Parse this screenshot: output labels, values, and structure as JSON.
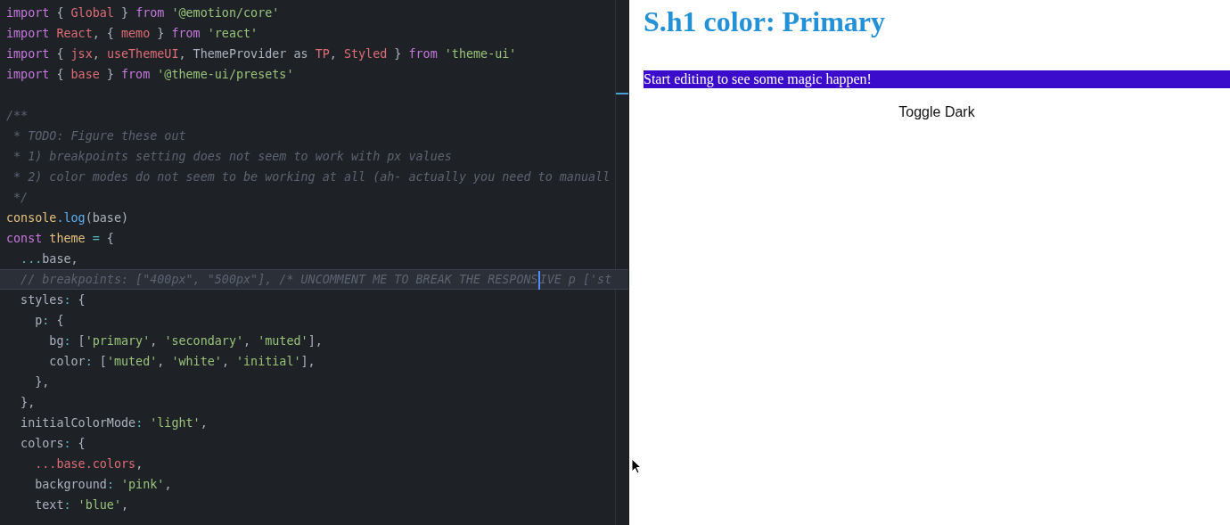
{
  "editor": {
    "lines": [
      {
        "current": false,
        "tokens": [
          {
            "kind": "keyword",
            "text": "import"
          },
          {
            "kind": "plain",
            "text": " { "
          },
          {
            "kind": "variable",
            "text": "Global"
          },
          {
            "kind": "plain",
            "text": " } "
          },
          {
            "kind": "keyword",
            "text": "from"
          },
          {
            "kind": "string",
            "text": " '@emotion/core'"
          }
        ]
      },
      {
        "current": false,
        "tokens": [
          {
            "kind": "keyword",
            "text": "import"
          },
          {
            "kind": "variable",
            "text": " React"
          },
          {
            "kind": "plain",
            "text": ", { "
          },
          {
            "kind": "variable",
            "text": "memo"
          },
          {
            "kind": "plain",
            "text": " } "
          },
          {
            "kind": "keyword",
            "text": "from"
          },
          {
            "kind": "string",
            "text": " 'react'"
          }
        ]
      },
      {
        "current": false,
        "tokens": [
          {
            "kind": "keyword",
            "text": "import"
          },
          {
            "kind": "plain",
            "text": " { "
          },
          {
            "kind": "variable",
            "text": "jsx"
          },
          {
            "kind": "plain",
            "text": ", "
          },
          {
            "kind": "variable",
            "text": "useThemeUI"
          },
          {
            "kind": "plain",
            "text": ", ThemeProvider as "
          },
          {
            "kind": "variable",
            "text": "TP"
          },
          {
            "kind": "plain",
            "text": ", "
          },
          {
            "kind": "variable",
            "text": "Styled"
          },
          {
            "kind": "plain",
            "text": " } "
          },
          {
            "kind": "keyword",
            "text": "from"
          },
          {
            "kind": "string",
            "text": " 'theme-ui'"
          }
        ]
      },
      {
        "current": false,
        "tokens": [
          {
            "kind": "keyword",
            "text": "import"
          },
          {
            "kind": "plain",
            "text": " { "
          },
          {
            "kind": "variable",
            "text": "base"
          },
          {
            "kind": "plain",
            "text": " } "
          },
          {
            "kind": "keyword",
            "text": "from"
          },
          {
            "kind": "string",
            "text": " '@theme-ui/presets'"
          }
        ]
      },
      {
        "current": false
      },
      {
        "current": false,
        "tokens": [
          {
            "kind": "comment",
            "text": "/**"
          }
        ]
      },
      {
        "current": false,
        "tokens": [
          {
            "kind": "comment",
            "text": " * TODO: Figure these out"
          }
        ]
      },
      {
        "current": false,
        "tokens": [
          {
            "kind": "comment",
            "text": " * 1) breakpoints setting does not seem to work with px values"
          }
        ]
      },
      {
        "current": false,
        "tokens": [
          {
            "kind": "comment",
            "text": " * 2) color modes do not seem to be working at all (ah- actually you need to manuall"
          }
        ]
      },
      {
        "current": false,
        "tokens": [
          {
            "kind": "comment",
            "text": " */"
          }
        ]
      },
      {
        "current": false,
        "tokens": [
          {
            "kind": "object",
            "text": "console"
          },
          {
            "kind": "function",
            "text": ".log"
          },
          {
            "kind": "plain",
            "text": "(base)"
          }
        ]
      },
      {
        "current": false,
        "tokens": [
          {
            "kind": "keyword",
            "text": "const"
          },
          {
            "kind": "object",
            "text": " theme"
          },
          {
            "kind": "operator",
            "text": " ="
          },
          {
            "kind": "plain",
            "text": " {"
          }
        ]
      },
      {
        "current": false,
        "tokens": [
          {
            "kind": "operator",
            "text": "  ..."
          },
          {
            "kind": "plain",
            "text": "base,"
          }
        ]
      },
      {
        "current": true,
        "tokens": [
          {
            "kind": "comment",
            "text": "  // breakpoints: [\"400px\", \"500px\"], /* UNCOMMENT ME TO BREAK THE RESPONS"
          },
          {
            "kind": "caret"
          },
          {
            "kind": "comment",
            "text": "IVE p ['st"
          }
        ]
      },
      {
        "current": false,
        "tokens": [
          {
            "kind": "plain",
            "text": "  styles"
          },
          {
            "kind": "operator",
            "text": ":"
          },
          {
            "kind": "plain",
            "text": " {"
          }
        ]
      },
      {
        "current": false,
        "tokens": [
          {
            "kind": "plain",
            "text": "    p"
          },
          {
            "kind": "operator",
            "text": ":"
          },
          {
            "kind": "plain",
            "text": " {"
          }
        ]
      },
      {
        "current": false,
        "tokens": [
          {
            "kind": "plain",
            "text": "      bg"
          },
          {
            "kind": "operator",
            "text": ":"
          },
          {
            "kind": "plain",
            "text": " ["
          },
          {
            "kind": "string",
            "text": "'primary'"
          },
          {
            "kind": "plain",
            "text": ", "
          },
          {
            "kind": "string",
            "text": "'secondary'"
          },
          {
            "kind": "plain",
            "text": ", "
          },
          {
            "kind": "string",
            "text": "'muted'"
          },
          {
            "kind": "plain",
            "text": "],"
          }
        ]
      },
      {
        "current": false,
        "tokens": [
          {
            "kind": "plain",
            "text": "      color"
          },
          {
            "kind": "operator",
            "text": ":"
          },
          {
            "kind": "plain",
            "text": " ["
          },
          {
            "kind": "string",
            "text": "'muted'"
          },
          {
            "kind": "plain",
            "text": ", "
          },
          {
            "kind": "string",
            "text": "'white'"
          },
          {
            "kind": "plain",
            "text": ", "
          },
          {
            "kind": "string",
            "text": "'initial'"
          },
          {
            "kind": "plain",
            "text": "],"
          }
        ]
      },
      {
        "current": false,
        "tokens": [
          {
            "kind": "plain",
            "text": "    },"
          }
        ]
      },
      {
        "current": false,
        "tokens": [
          {
            "kind": "plain",
            "text": "  },"
          }
        ]
      },
      {
        "current": false,
        "tokens": [
          {
            "kind": "plain",
            "text": "  initialColorMode"
          },
          {
            "kind": "operator",
            "text": ":"
          },
          {
            "kind": "string",
            "text": " 'light'"
          },
          {
            "kind": "plain",
            "text": ","
          }
        ]
      },
      {
        "current": false,
        "tokens": [
          {
            "kind": "plain",
            "text": "  colors"
          },
          {
            "kind": "operator",
            "text": ":"
          },
          {
            "kind": "plain",
            "text": " {"
          }
        ]
      },
      {
        "current": false,
        "tokens": [
          {
            "kind": "variable",
            "text": "    ...base.colors"
          },
          {
            "kind": "plain",
            "text": ","
          }
        ]
      },
      {
        "current": false,
        "tokens": [
          {
            "kind": "plain",
            "text": "    background"
          },
          {
            "kind": "operator",
            "text": ":"
          },
          {
            "kind": "string",
            "text": " 'pink'"
          },
          {
            "kind": "plain",
            "text": ","
          }
        ]
      },
      {
        "current": false,
        "tokens": [
          {
            "kind": "plain",
            "text": "    text"
          },
          {
            "kind": "operator",
            "text": ":"
          },
          {
            "kind": "string",
            "text": " 'blue'"
          },
          {
            "kind": "plain",
            "text": ","
          }
        ]
      }
    ]
  },
  "preview": {
    "heading": "S.h1 color: Primary",
    "banner": "Start editing to see some magic happen!",
    "toggle_button": "Toggle Dark"
  }
}
